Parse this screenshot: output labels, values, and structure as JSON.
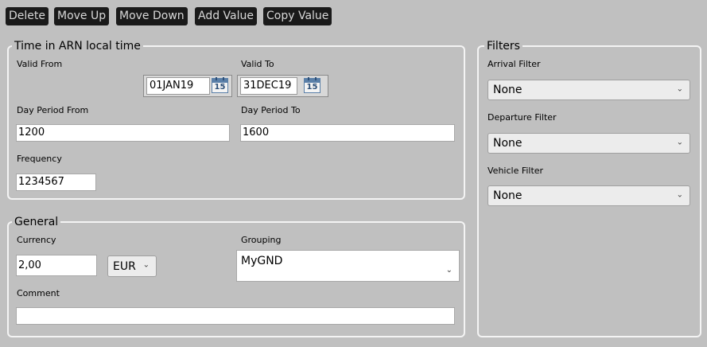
{
  "toolbar": {
    "delete": "Delete",
    "move_up": "Move Up",
    "move_down": "Move Down",
    "add_value": "Add Value",
    "copy_value": "Copy Value"
  },
  "time_group": {
    "title": "Time in ARN local time",
    "valid_from_label": "Valid From",
    "valid_from_value": "01JAN19",
    "valid_to_label": "Valid To",
    "valid_to_value": "31DEC19",
    "calendar_day": "15",
    "day_period_from_label": "Day Period From",
    "day_period_from_value": "1200",
    "day_period_to_label": "Day Period To",
    "day_period_to_value": "1600",
    "frequency_label": "Frequency",
    "frequency_value": "1234567"
  },
  "general_group": {
    "title": "General",
    "currency_label": "Currency",
    "currency_amount": "2,00",
    "currency_code": "EUR",
    "grouping_label": "Grouping",
    "grouping_value": "MyGND",
    "comment_label": "Comment",
    "comment_value": ""
  },
  "filters_group": {
    "title": "Filters",
    "arrival_label": "Arrival Filter",
    "arrival_value": "None",
    "departure_label": "Departure Filter",
    "departure_value": "None",
    "vehicle_label": "Vehicle Filter",
    "vehicle_value": "None"
  },
  "icons": {
    "dropdown": "chevron-down-icon",
    "calendar": "calendar-icon"
  },
  "colors": {
    "background": "#c0c0c0",
    "toolbar_button": "#1a1a1a",
    "toolbar_text": "#d8d8d8",
    "group_border": "#f4f4f4"
  }
}
